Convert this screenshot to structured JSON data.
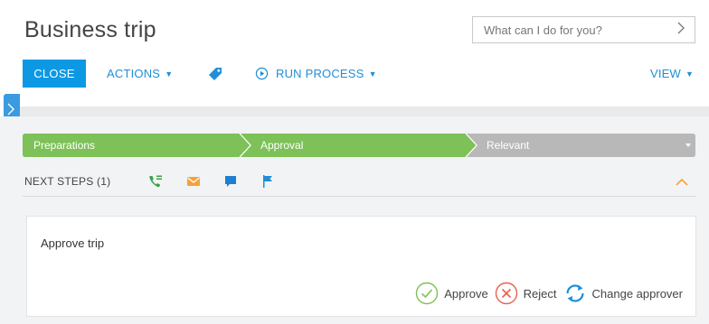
{
  "page": {
    "title": "Business trip"
  },
  "search": {
    "placeholder": "What can I do for you?",
    "icon": "chevron-right-icon"
  },
  "toolbar": {
    "close_label": "CLOSE",
    "actions_label": "ACTIONS",
    "run_process_label": "RUN PROCESS",
    "view_label": "VIEW",
    "tag_icon": "tag-icon",
    "run_icon": "play-circle-icon"
  },
  "dcm": {
    "stages": [
      {
        "label": "Preparations",
        "color": "#7dc158"
      },
      {
        "label": "Approval",
        "color": "#7dc158"
      },
      {
        "label": "Relevant",
        "color": "#b8b8b8"
      }
    ]
  },
  "next_steps": {
    "label": "NEXT STEPS (1)",
    "icons": [
      "phone-icon",
      "email-icon",
      "chat-icon",
      "flag-icon"
    ]
  },
  "task": {
    "title": "Approve trip",
    "approve_label": "Approve",
    "reject_label": "Reject",
    "change_approver_label": "Change approver"
  },
  "colors": {
    "accent": "#0d98e4",
    "link": "#1f8fd8",
    "stage_active": "#7dc158",
    "stage_inactive": "#b8b8b8",
    "approve": "#7dc158",
    "reject": "#e8614f",
    "collapse_arrow": "#f5a13a"
  }
}
